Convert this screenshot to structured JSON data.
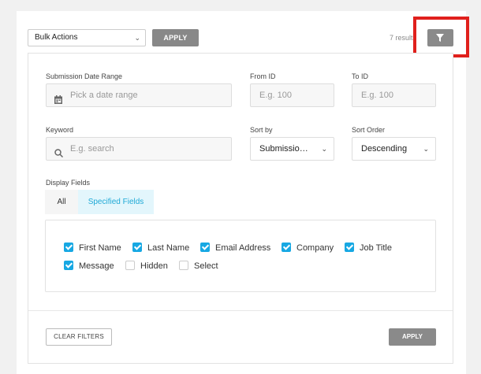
{
  "toolbar": {
    "bulk_actions": "Bulk Actions",
    "apply_label": "APPLY",
    "results_text": "7 results"
  },
  "filters": {
    "date_range_label": "Submission Date Range",
    "date_range_placeholder": "Pick a date range",
    "from_id_label": "From ID",
    "from_id_placeholder": "E.g. 100",
    "to_id_label": "To ID",
    "to_id_placeholder": "E.g. 100",
    "keyword_label": "Keyword",
    "keyword_placeholder": "E.g. search",
    "sort_by_label": "Sort by",
    "sort_by_value": "Submissio…",
    "sort_order_label": "Sort Order",
    "sort_order_value": "Descending",
    "display_fields_label": "Display Fields",
    "tabs": [
      {
        "label": "All",
        "active": false
      },
      {
        "label": "Specified Fields",
        "active": true
      }
    ],
    "fields": [
      {
        "label": "First Name",
        "checked": true
      },
      {
        "label": "Last Name",
        "checked": true
      },
      {
        "label": "Email Address",
        "checked": true
      },
      {
        "label": "Company",
        "checked": true
      },
      {
        "label": "Job Title",
        "checked": true
      },
      {
        "label": "Message",
        "checked": true
      },
      {
        "label": "Hidden",
        "checked": false
      },
      {
        "label": "Select",
        "checked": false
      }
    ],
    "clear_label": "CLEAR FILTERS",
    "apply_label": "APPLY"
  },
  "colors": {
    "accent": "#17a8e3",
    "highlight": "#e0201c",
    "button_gray": "#8a8a8a"
  }
}
